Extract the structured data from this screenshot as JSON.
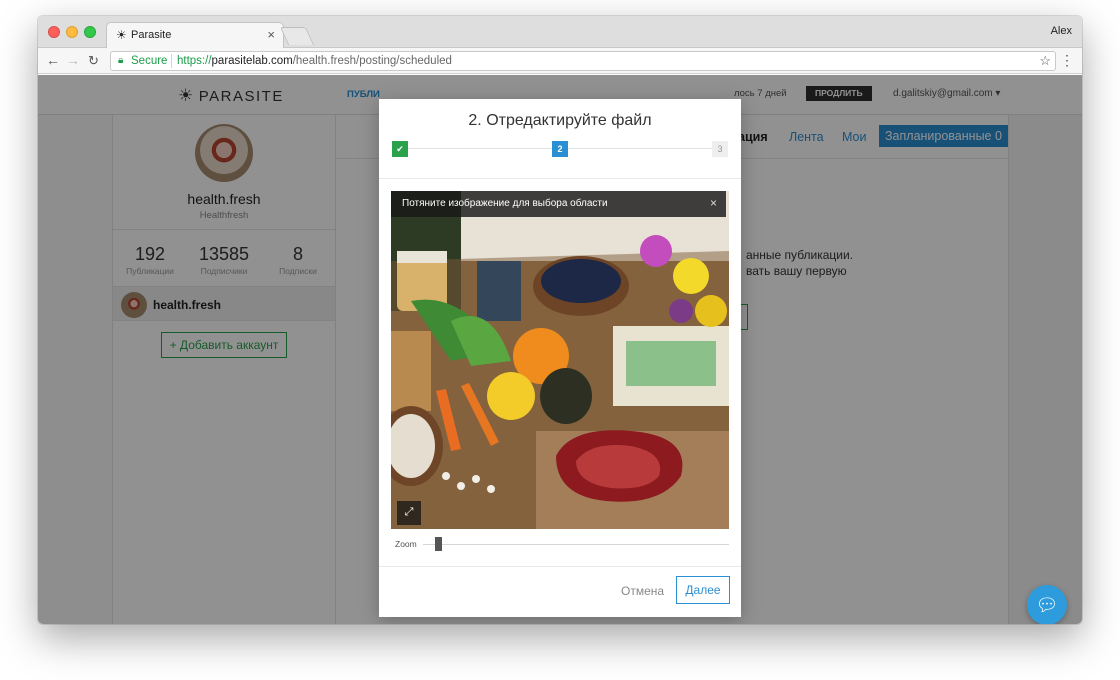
{
  "browser": {
    "tab_title": "Parasite",
    "tab_close": "×",
    "user": "Alex",
    "secure_label": "Secure",
    "url_scheme": "https://",
    "url_host": "parasitelab.com",
    "url_path": "/health.fresh/posting/scheduled"
  },
  "site": {
    "logo": "PARASITE",
    "nav_partial": "ПУБЛИ",
    "trial_partial": "лось 7 дней",
    "extend_label": "ПРОДЛИТЬ",
    "account_email": "d.galitskiy@gmail.com"
  },
  "profile": {
    "name": "health.fresh",
    "subname": "Healthfresh",
    "stats": [
      {
        "value": "192",
        "label": "Публикации"
      },
      {
        "value": "13585",
        "label": "Подписчики"
      },
      {
        "value": "8",
        "label": "Подписки"
      }
    ],
    "account_row_name": "health.fresh",
    "add_account_label": "+ Добавить аккаунт"
  },
  "main": {
    "tabs": {
      "publication_partial": "ация",
      "feed": "Лента",
      "mine": "Мои",
      "scheduled": "Запланированные 0"
    },
    "bg_line1": "анные публикации.",
    "bg_line2": "вать вашу первую"
  },
  "modal": {
    "title": "2. Отредактируйте файл",
    "steps": [
      "✔",
      "2",
      "3"
    ],
    "hint": "Потяните изображение для выбора области",
    "hint_close": "×",
    "expand_icon": "⤢",
    "zoom_label": "Zoom",
    "zoom_level": 0.04,
    "cancel_label": "Отмена",
    "next_label": "Далее"
  },
  "colors": {
    "accent_blue": "#2b8fd4",
    "accent_green": "#2aa14b",
    "chat_blue": "#2e9cdc"
  },
  "icons": [
    "sun-logo-icon",
    "lock-icon",
    "star-icon",
    "menu-dots-icon",
    "close-icon",
    "check-icon",
    "expand-icon",
    "chat-icon"
  ]
}
